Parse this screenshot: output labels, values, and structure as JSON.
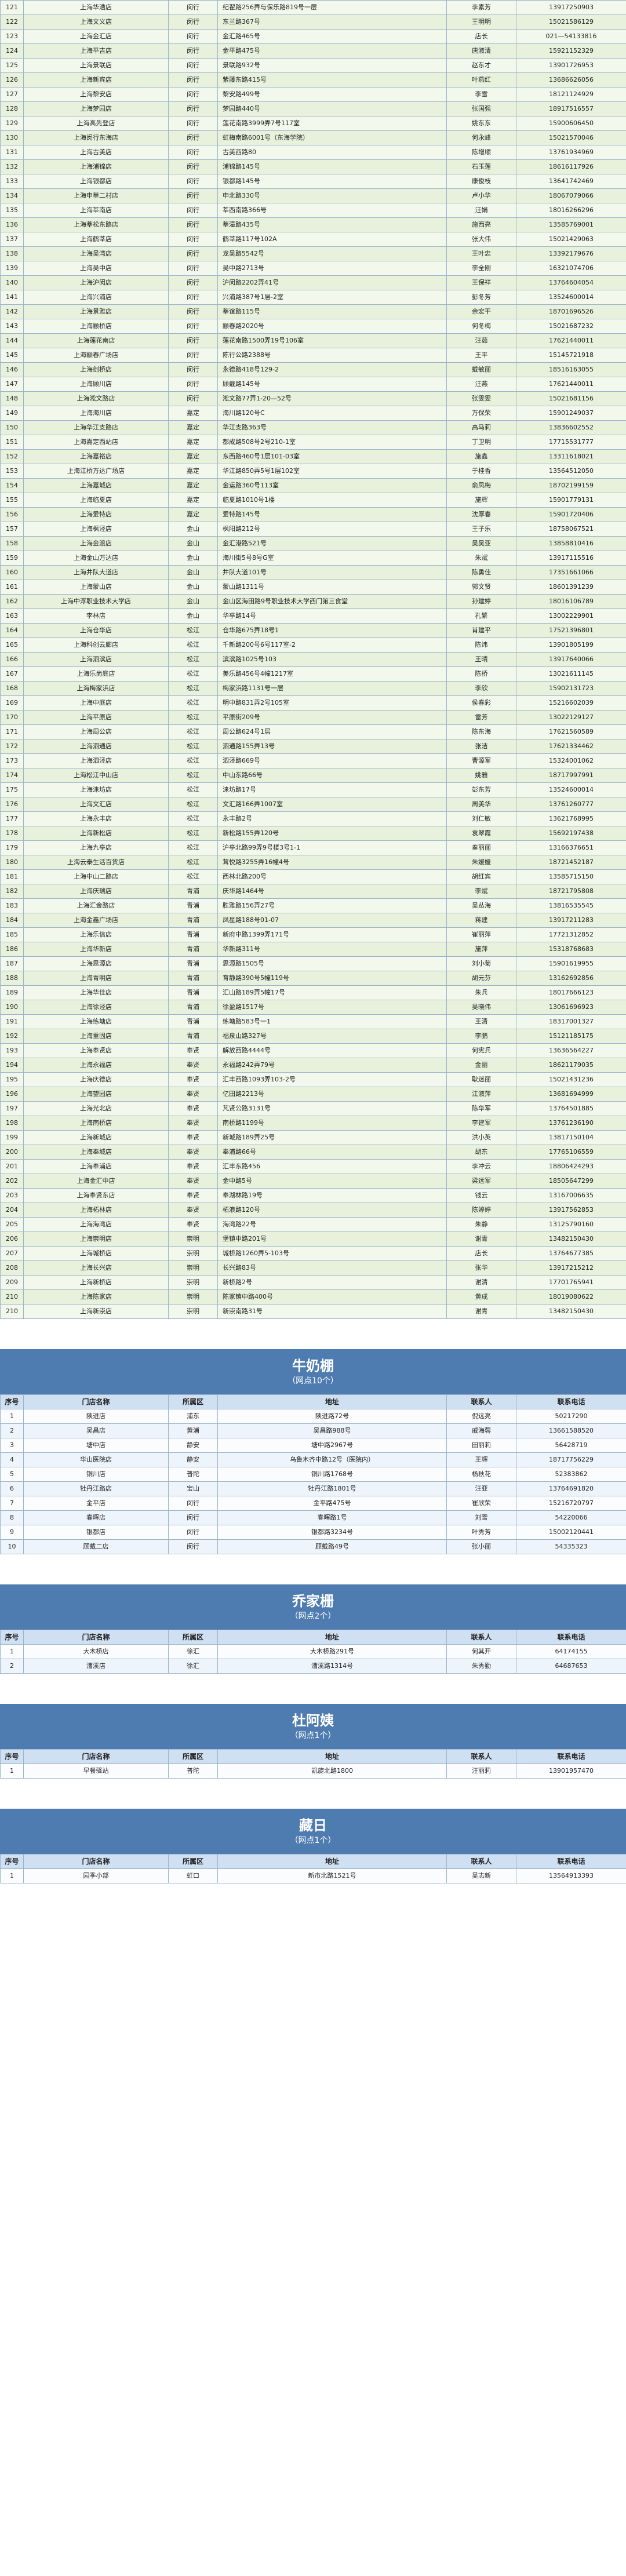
{
  "rows_a": [
    [
      "121",
      "上海华漕店",
      "闵行",
      "纪翟路256弄与保乐路819号一层",
      "李素芳",
      "13917250903"
    ],
    [
      "122",
      "上海文义店",
      "闵行",
      "东兰路367号",
      "王明明",
      "15021586129"
    ],
    [
      "123",
      "上海金汇店",
      "闵行",
      "金汇路465号",
      "店长",
      "021—54133816"
    ],
    [
      "124",
      "上海平吉店",
      "闵行",
      "金平路475号",
      "唐淑清",
      "15921152329"
    ],
    [
      "125",
      "上海景联店",
      "闵行",
      "景联路932号",
      "赵东才",
      "13901726953"
    ],
    [
      "126",
      "上海新宾店",
      "闵行",
      "紫藤东路415号",
      "叶燕红",
      "13686626056"
    ],
    [
      "127",
      "上海黎安店",
      "闵行",
      "黎安路499号",
      "李雪",
      "18121124929"
    ],
    [
      "128",
      "上海梦园店",
      "闵行",
      "梦园路440号",
      "张国强",
      "18917516557"
    ],
    [
      "129",
      "上海高先登店",
      "闵行",
      "莲花南路3999弄7号117室",
      "姚东东",
      "15900606450"
    ],
    [
      "130",
      "上海闵行东海店",
      "闵行",
      "虹梅南路6001号（东海学院）",
      "何永峰",
      "15021570046"
    ],
    [
      "131",
      "上海古美店",
      "闵行",
      "古美西路80",
      "陈增顺",
      "13761934969"
    ],
    [
      "132",
      "上海浦锦店",
      "闵行",
      "浦锦路145号",
      "石玉莲",
      "18616117926"
    ],
    [
      "133",
      "上海银都店",
      "闵行",
      "银都路145号",
      "康俊枝",
      "13641742469"
    ],
    [
      "134",
      "上海申莘二村店",
      "闵行",
      "申北路330号",
      "卢小华",
      "18067079066"
    ],
    [
      "135",
      "上海莘南店",
      "闵行",
      "莘西南路366号",
      "汪娟",
      "18016266296"
    ],
    [
      "136",
      "上海莘松东路店",
      "闵行",
      "莘潼路435号",
      "施西亮",
      "13585769001"
    ],
    [
      "137",
      "上海鹤莘店",
      "闵行",
      "鹤莘路117号102A",
      "张大伟",
      "15021429063"
    ],
    [
      "138",
      "上海吴湾店",
      "闵行",
      "龙吴路5542号",
      "王叶忠",
      "13392179676"
    ],
    [
      "139",
      "上海吴中店",
      "闵行",
      "吴中路2713号",
      "李全刚",
      "16321074706"
    ],
    [
      "140",
      "上海沪闵店",
      "闵行",
      "沪闵路2202弄41号",
      "王保祥",
      "13764604054"
    ],
    [
      "141",
      "上海兴浦店",
      "闵行",
      "兴浦路387号1层-2室",
      "彭冬芳",
      "13524600014"
    ],
    [
      "142",
      "上海景雅店",
      "闵行",
      "莘谊路115号",
      "余宏干",
      "18701696526"
    ],
    [
      "143",
      "上海颛桥店",
      "闵行",
      "颛春路2020号",
      "何冬梅",
      "15021687232"
    ],
    [
      "144",
      "上海莲花南店",
      "闵行",
      "莲花南路1500弄19号106室",
      "汪茹",
      "17621440011"
    ],
    [
      "145",
      "上海颛春广场店",
      "闵行",
      "陈行公路2388号",
      "王平",
      "15145721918"
    ],
    [
      "146",
      "上海剑桥店",
      "闵行",
      "永德路418号129-2",
      "戴敏丽",
      "18516163055"
    ],
    [
      "147",
      "上海顾川店",
      "闵行",
      "顾戴路145号",
      "汪燕",
      "17621440011"
    ],
    [
      "148",
      "上海淞文路店",
      "闵行",
      "淞文路77弄1-20—52号",
      "张雯雯",
      "15021681156"
    ],
    [
      "149",
      "上海海川店",
      "嘉定",
      "海川路120号C",
      "万保荣",
      "15901249037"
    ],
    [
      "150",
      "上海华江支路店",
      "嘉定",
      "华江支路363号",
      "高马莉",
      "13836602552"
    ],
    [
      "151",
      "上海嘉定西站店",
      "嘉定",
      "都成路508号2号210-1室",
      "丁卫明",
      "17715531777"
    ],
    [
      "152",
      "上海嘉裕店",
      "嘉定",
      "东西路460号1层101-03室",
      "施鑫",
      "13311618021"
    ],
    [
      "153",
      "上海江桥万达广场店",
      "嘉定",
      "华江路850弄5号1层102室",
      "于桂香",
      "13564512050"
    ],
    [
      "154",
      "上海嘉城店",
      "嘉定",
      "金运路360号113室",
      "俞凤梅",
      "18702199159"
    ],
    [
      "155",
      "上海临夏店",
      "嘉定",
      "临夏路1010号1楼",
      "施辉",
      "15901779131"
    ],
    [
      "156",
      "上海爱特店",
      "嘉定",
      "爱特路145号",
      "沈厚春",
      "15901720406"
    ],
    [
      "157",
      "上海枫泾店",
      "金山",
      "枫阳路212号",
      "王子乐",
      "18758067521"
    ],
    [
      "158",
      "上海金渡店",
      "金山",
      "金汇港路521号",
      "吴吴亚",
      "13858810416"
    ],
    [
      "159",
      "上海金山万达店",
      "金山",
      "海川街5号8号G室",
      "朱斌",
      "13917115516"
    ],
    [
      "160",
      "上海井队大道店",
      "金山",
      "井队大道101号",
      "陈勇佳",
      "17351661066"
    ],
    [
      "161",
      "上海蒙山店",
      "金山",
      "蒙山路1311号",
      "郭文贤",
      "18601391239"
    ],
    [
      "162",
      "上海中浮职业技术大学店",
      "金山",
      "金山区海田路9号职业技术大学西门第三食堂",
      "孙建婷",
      "18016106789"
    ],
    [
      "163",
      "李林店",
      "金山",
      "华亭路14号",
      "孔繁",
      "13002229901"
    ],
    [
      "164",
      "上海仓华店",
      "松江",
      "仓华路675弄18号1",
      "肖建平",
      "17521396801"
    ],
    [
      "165",
      "上海科创云廊店",
      "松江",
      "千新路200号6号117室-2",
      "陈炜",
      "13901805199"
    ],
    [
      "166",
      "上海泗滨店",
      "松江",
      "滨滨路1025号103",
      "王晴",
      "13917640066"
    ],
    [
      "167",
      "上海乐尚庭店",
      "松江",
      "美乐路456号4幢1217室",
      "陈桥",
      "13021611145"
    ],
    [
      "168",
      "上海梅家浜店",
      "松江",
      "梅家浜路1131号一层",
      "李欣",
      "15902131723"
    ],
    [
      "169",
      "上海中庭店",
      "松江",
      "明中路831弄2号105室",
      "侯春彩",
      "15216602039"
    ],
    [
      "170",
      "上海平原店",
      "松江",
      "平原街209号",
      "雷芳",
      "13022129127"
    ],
    [
      "171",
      "上海周公店",
      "松江",
      "周公路624号1层",
      "陈东海",
      "17621560589"
    ],
    [
      "172",
      "上海泗通店",
      "松江",
      "泗通路155弄13号",
      "张洁",
      "17621334462"
    ],
    [
      "173",
      "上海泗泾店",
      "松江",
      "泗泾路669号",
      "曹源军",
      "15324001062"
    ],
    [
      "174",
      "上海松江中山店",
      "松江",
      "中山东路66号",
      "姚雅",
      "18717997991"
    ],
    [
      "175",
      "上海涞坊店",
      "松江",
      "涞坊路17号",
      "彭东芳",
      "13524600014"
    ],
    [
      "176",
      "上海文汇店",
      "松江",
      "文汇路166弄1007室",
      "周美华",
      "13761260777"
    ],
    [
      "177",
      "上海永丰店",
      "松江",
      "永丰路2号",
      "刘仁敏",
      "13621768995"
    ],
    [
      "178",
      "上海新松店",
      "松江",
      "新松路155弄120号",
      "袁翠霞",
      "15692197438"
    ],
    [
      "179",
      "上海九亭店",
      "松江",
      "沪亭北路99弄9号楼3号1-1",
      "秦丽丽",
      "13166376651"
    ],
    [
      "180",
      "上海云泰生活百货店",
      "松江",
      "茸悦路3255弄16幢4号",
      "朱媛媛",
      "18721452187"
    ],
    [
      "181",
      "上海中山二路店",
      "松江",
      "西林北路200号",
      "胡红宾",
      "13585715150"
    ],
    [
      "182",
      "上海庆瑞店",
      "青浦",
      "庆华路1464号",
      "李斌",
      "18721795808"
    ],
    [
      "183",
      "上海汇金路店",
      "青浦",
      "胜雅路156弄27号",
      "吴丛海",
      "13816535545"
    ],
    [
      "184",
      "上海金鑫广场店",
      "青浦",
      "凤星路188号01-07",
      "蒋建",
      "13917211283"
    ],
    [
      "185",
      "上海乐信店",
      "青浦",
      "新府中路1399弄171号",
      "崔丽萍",
      "17721312852"
    ],
    [
      "186",
      "上海华新店",
      "青浦",
      "华新路311号",
      "施萍",
      "15318768683"
    ],
    [
      "187",
      "上海思源店",
      "青浦",
      "思源路1505号",
      "刘小菊",
      "15901619955"
    ],
    [
      "188",
      "上海青明店",
      "青浦",
      "育静路390号5幢119号",
      "胡元芬",
      "13162692856"
    ],
    [
      "189",
      "上海华佳店",
      "青浦",
      "汇山路189弄5幢17号",
      "朱兵",
      "18017666123"
    ],
    [
      "190",
      "上海徐泾店",
      "青浦",
      "徐盈路1517号",
      "吴晓伟",
      "13061696923"
    ],
    [
      "191",
      "上海练塘店",
      "青浦",
      "练塘路583号一1",
      "王清",
      "18317001327"
    ],
    [
      "192",
      "上海重固店",
      "青浦",
      "福泉山路327号",
      "李鹏",
      "15121185175"
    ],
    [
      "193",
      "上海奉贤店",
      "奉贤",
      "解放西路4444号",
      "何宪兵",
      "13636564227"
    ],
    [
      "194",
      "上海永福店",
      "奉贤",
      "永福路242弄79号",
      "金丽",
      "18621179035"
    ],
    [
      "195",
      "上海庆德店",
      "奉贤",
      "汇丰西路1093弄103-2号",
      "耿迷丽",
      "15021431236"
    ],
    [
      "196",
      "上海望园店",
      "奉贤",
      "亿田路2213号",
      "江淑萍",
      "13681694999"
    ],
    [
      "197",
      "上海光北店",
      "奉贤",
      "芃贤公路3131号",
      "陈华军",
      "13764501885"
    ],
    [
      "198",
      "上海南桥店",
      "奉贤",
      "南桥路1199号",
      "李建军",
      "13761236190"
    ],
    [
      "199",
      "上海新城店",
      "奉贤",
      "新城路189弄25号",
      "洪小英",
      "13817150104"
    ],
    [
      "200",
      "上海奉城店",
      "奉贤",
      "奉浦路66号",
      "胡东",
      "17765106559"
    ],
    [
      "201",
      "上海奉浦店",
      "奉贤",
      "汇丰东路456",
      "李冲云",
      "18806424293"
    ],
    [
      "202",
      "上海金汇中店",
      "奉贤",
      "金中路5号",
      "梁远军",
      "18505647299"
    ],
    [
      "203",
      "上海奉贤东店",
      "奉贤",
      "奉湖林路19号",
      "钱云",
      "13167006635"
    ],
    [
      "204",
      "上海柘林店",
      "奉贤",
      "柘浪路120号",
      "陈婷婷",
      "13917562853"
    ],
    [
      "205",
      "上海海湾店",
      "奉贤",
      "海湾路22号",
      "朱静",
      "13125790160"
    ],
    [
      "206",
      "上海崇明店",
      "崇明",
      "堡镇中路201号",
      "谢青",
      "13482150430"
    ],
    [
      "207",
      "上海城桥店",
      "崇明",
      "城桥路1260弄5-103号",
      "店长",
      "13764677385"
    ],
    [
      "208",
      "上海长兴店",
      "崇明",
      "长兴路83号",
      "张华",
      "13917215212"
    ],
    [
      "209",
      "上海新桥店",
      "崇明",
      "新桥路2号",
      "谢清",
      "17701765941"
    ],
    [
      "210",
      "上海陈家店",
      "崇明",
      "陈家镇中路400号",
      "黄成",
      "18019080622"
    ],
    [
      "210",
      "上海新崇店",
      "崇明",
      "新崇南路31号",
      "谢青",
      "13482150430"
    ]
  ],
  "header": {
    "c0": "序号",
    "c1": "门店名称",
    "c2": "所属区",
    "c3": "地址",
    "c4": "联系人",
    "c5": "联系电话"
  },
  "sections": [
    {
      "title": "牛奶棚",
      "subtitle": "（网点10个）",
      "rows": [
        [
          "1",
          "陕进店",
          "浦东",
          "陕进路72号",
          "倪远亮",
          "50217290"
        ],
        [
          "2",
          "吴昌店",
          "黄浦",
          "吴昌路988号",
          "戚海蓉",
          "13661588520"
        ],
        [
          "3",
          "塘中店",
          "静安",
          "塘中路2967号",
          "田丽莉",
          "56428719"
        ],
        [
          "4",
          "华山医院店",
          "静安",
          "乌鲁木齐中路12号（医院内）",
          "王辉",
          "18717756229"
        ],
        [
          "5",
          "铜川店",
          "普陀",
          "铜川路1768号",
          "杨秋花",
          "52383862"
        ],
        [
          "6",
          "牡丹江路店",
          "宝山",
          "牡丹江路1801号",
          "汪亚",
          "13764691820"
        ],
        [
          "7",
          "金平店",
          "闵行",
          "金平路475号",
          "崔欣荣",
          "15216720797"
        ],
        [
          "8",
          "春晖店",
          "闵行",
          "春晖路1号",
          "刘雪",
          "54220066"
        ],
        [
          "9",
          "银都店",
          "闵行",
          "银都路3234号",
          "叶秀芳",
          "15002120441"
        ],
        [
          "10",
          "顾戴二店",
          "闵行",
          "顾戴路49号",
          "张小丽",
          "54335323"
        ]
      ]
    },
    {
      "title": "乔家栅",
      "subtitle": "（网点2个）",
      "rows": [
        [
          "1",
          "大木桥店",
          "徐汇",
          "大木桥路291号",
          "何其开",
          "64174155"
        ],
        [
          "2",
          "漕溪店",
          "徐汇",
          "漕溪路1314号",
          "朱秀勤",
          "64687653"
        ]
      ]
    },
    {
      "title": "杜阿姨",
      "subtitle": "（网点1个）",
      "rows": [
        [
          "1",
          "早餐驿站",
          "普陀",
          "凯旋北路1800",
          "汪丽莉",
          "13901957470"
        ]
      ]
    },
    {
      "title": "藏日",
      "subtitle": "（网点1个）",
      "rows": [
        [
          "1",
          "园季小部",
          "虹口",
          "新市北路1521号",
          "吴志新",
          "13564913393"
        ]
      ]
    }
  ]
}
